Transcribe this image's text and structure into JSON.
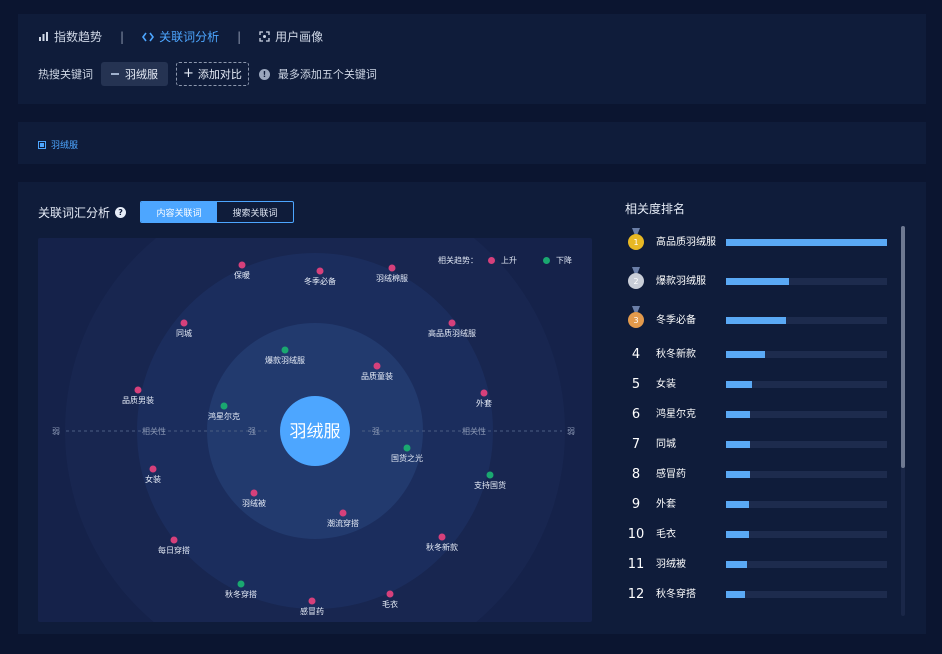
{
  "nav": {
    "items": [
      {
        "label": "指数趋势",
        "icon": "bar-chart-icon",
        "active": false
      },
      {
        "label": "关联词分析",
        "icon": "code-arrows-icon",
        "active": true
      },
      {
        "label": "用户画像",
        "icon": "focus-scan-icon",
        "active": false
      }
    ],
    "separator": "|"
  },
  "hot_search": {
    "label": "热搜关键词",
    "keyword": "羽绒服",
    "add_button": "添加对比",
    "hint": "最多添加五个关键词"
  },
  "keyword_tag": "羽绒服",
  "analysis": {
    "title": "关联词汇分析",
    "tabs": [
      "内容关联词",
      "搜索关联词"
    ],
    "active_tab": 0,
    "legend_label": "相关趋势：",
    "legend_up": "上升",
    "legend_down": "下降",
    "up_color": "#d6407b",
    "down_color": "#1aa870",
    "center_word": "羽绒服",
    "axis_labels": {
      "weak": "弱",
      "strong": "强",
      "relevance": "相关性"
    },
    "words": [
      {
        "label": "保暖",
        "trend": "up"
      },
      {
        "label": "冬季必备",
        "trend": "up"
      },
      {
        "label": "羽绒棉服",
        "trend": "up"
      },
      {
        "label": "同城",
        "trend": "up"
      },
      {
        "label": "高品质羽绒服",
        "trend": "up"
      },
      {
        "label": "爆款羽绒服",
        "trend": "down"
      },
      {
        "label": "品质童装",
        "trend": "up"
      },
      {
        "label": "品质男装",
        "trend": "up"
      },
      {
        "label": "鸿星尔克",
        "trend": "down"
      },
      {
        "label": "外套",
        "trend": "up"
      },
      {
        "label": "国货之光",
        "trend": "down"
      },
      {
        "label": "女装",
        "trend": "up"
      },
      {
        "label": "支持国货",
        "trend": "down"
      },
      {
        "label": "羽绒被",
        "trend": "up"
      },
      {
        "label": "潮流穿搭",
        "trend": "up"
      },
      {
        "label": "秋冬新款",
        "trend": "up"
      },
      {
        "label": "每日穿搭",
        "trend": "up"
      },
      {
        "label": "秋冬穿搭",
        "trend": "down"
      },
      {
        "label": "毛衣",
        "trend": "up"
      },
      {
        "label": "感冒药",
        "trend": "up"
      }
    ]
  },
  "ranking": {
    "title": "相关度排名",
    "medal_colors": [
      "#e8b824",
      "#c9ced8",
      "#e39a4c"
    ],
    "items": [
      {
        "rank": "1",
        "name": "高品质羽绒服",
        "value": 1.0
      },
      {
        "rank": "2",
        "name": "爆款羽绒服",
        "value": 0.39
      },
      {
        "rank": "3",
        "name": "冬季必备",
        "value": 0.37
      },
      {
        "rank": "4",
        "name": "秋冬新款",
        "value": 0.24
      },
      {
        "rank": "5",
        "name": "女装",
        "value": 0.16
      },
      {
        "rank": "6",
        "name": "鸿星尔克",
        "value": 0.15
      },
      {
        "rank": "7",
        "name": "同城",
        "value": 0.15
      },
      {
        "rank": "8",
        "name": "感冒药",
        "value": 0.15
      },
      {
        "rank": "9",
        "name": "外套",
        "value": 0.14
      },
      {
        "rank": "10",
        "name": "毛衣",
        "value": 0.14
      },
      {
        "rank": "11",
        "name": "羽绒被",
        "value": 0.13
      },
      {
        "rank": "12",
        "name": "秋冬穿搭",
        "value": 0.12
      }
    ]
  }
}
